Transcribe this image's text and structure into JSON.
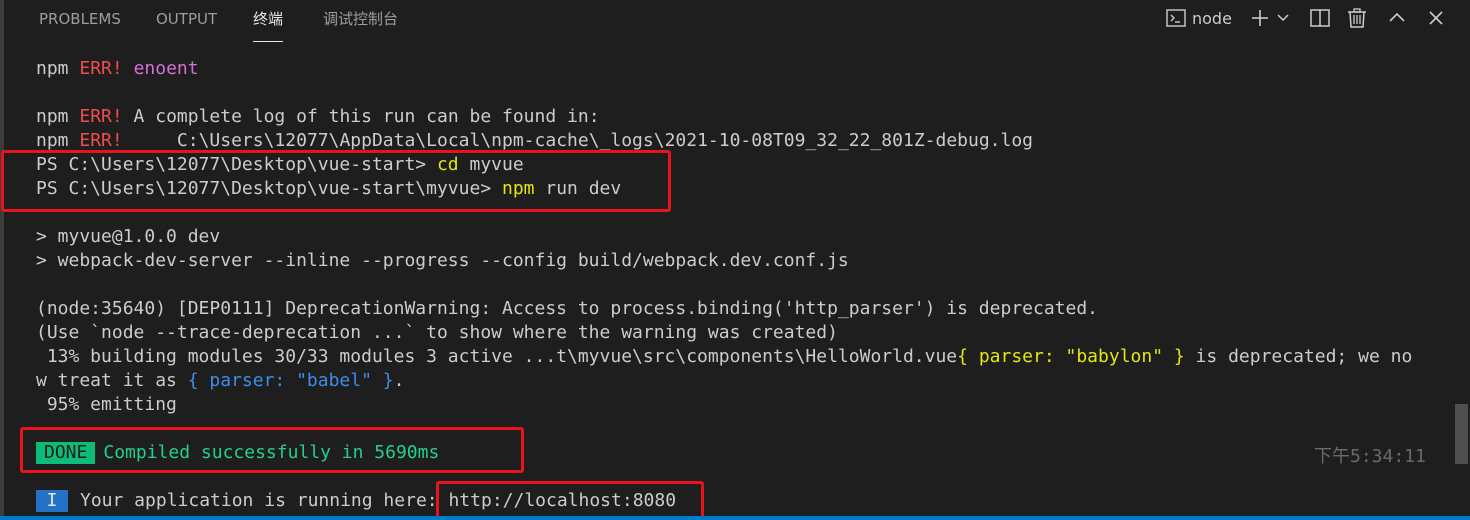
{
  "tabs": [
    {
      "label": "PROBLEMS"
    },
    {
      "label": "OUTPUT"
    },
    {
      "label": "终端"
    },
    {
      "label": "调试控制台"
    }
  ],
  "toolbar": {
    "shell_name": "node",
    "icons": [
      "terminal-icon",
      "plus-icon",
      "chevron-down-icon",
      "split-icon",
      "trash-icon",
      "chevron-up-icon",
      "close-icon"
    ]
  },
  "terminal": {
    "l1": {
      "a": "npm ",
      "b": "ERR!",
      "c": " ",
      "d": "enoent"
    },
    "l2": {
      "a": "npm ",
      "b": "ERR!",
      "c": " A complete log of this run can be found in:"
    },
    "l3": {
      "a": "npm ",
      "b": "ERR!",
      "c": "     C:\\Users\\12077\\AppData\\Local\\npm-cache\\_logs\\2021-10-08T09_32_22_801Z-debug.log"
    },
    "l4": {
      "a": "PS C:\\Users\\12077\\Desktop\\vue-start> ",
      "b": "cd",
      "c": " myvue"
    },
    "l5": {
      "a": "PS C:\\Users\\12077\\Desktop\\vue-start\\myvue> ",
      "b": "npm",
      "c": " run dev"
    },
    "l6": "> myvue@1.0.0 dev",
    "l7": "> webpack-dev-server --inline --progress --config build/webpack.dev.conf.js",
    "l8": "(node:35640) [DEP0111] DeprecationWarning: Access to process.binding('http_parser') is deprecated.",
    "l9": "(Use `node --trace-deprecation ...` to show where the warning was created)",
    "l10": {
      "a": " 13% building modules 30/33 modules 3 active ...t\\myvue\\src\\components\\HelloWorld.vue",
      "b": "{ parser: \"babylon\" }",
      "c": " is deprecated; we no"
    },
    "l11": {
      "a": "w treat it as ",
      "b": "{ parser: \"babel\" }",
      "c": "."
    },
    "l12": " 95% emitting",
    "done": {
      "badge": "DONE",
      "text": "Compiled successfully in 5690ms"
    },
    "timestamp": "下午5:34:11",
    "info": {
      "badge": "I",
      "text": "Your application is running here: ",
      "url": "http://localhost:8080"
    }
  },
  "colors": {
    "background": "#1e1e1e",
    "error_red": "#f14c4c",
    "command_yellow": "#e5e510",
    "success_green": "#0dbc79",
    "info_blue": "#2472c8",
    "highlight_box": "#e8141d"
  }
}
